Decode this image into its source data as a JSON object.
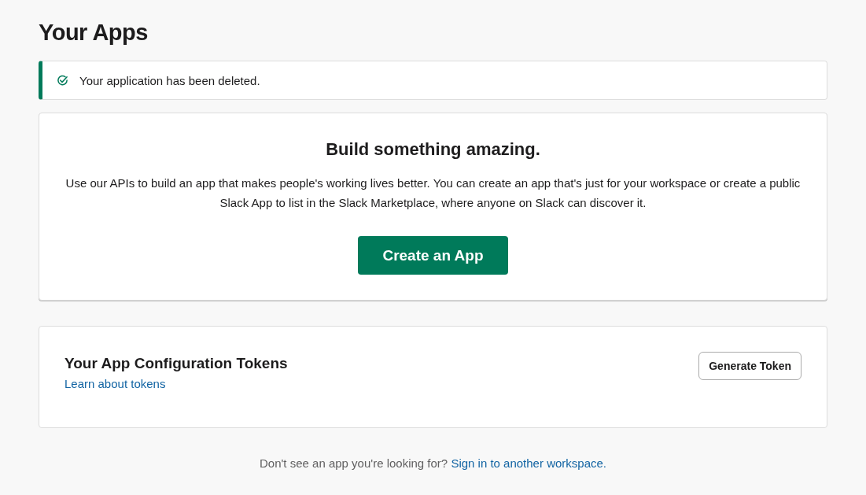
{
  "page_title": "Your Apps",
  "alert": {
    "message": "Your application has been deleted."
  },
  "hero": {
    "heading": "Build something amazing.",
    "description": "Use our APIs to build an app that makes people's working lives better. You can create an app that's just for your workspace or create a public Slack App to list in the Slack Marketplace, where anyone on Slack can discover it.",
    "button": "Create an App"
  },
  "tokens": {
    "heading": "Your App Configuration Tokens",
    "link": "Learn about tokens",
    "button": "Generate Token"
  },
  "footer": {
    "text": "Don't see an app you're looking for?",
    "link": "Sign in to another workspace."
  }
}
